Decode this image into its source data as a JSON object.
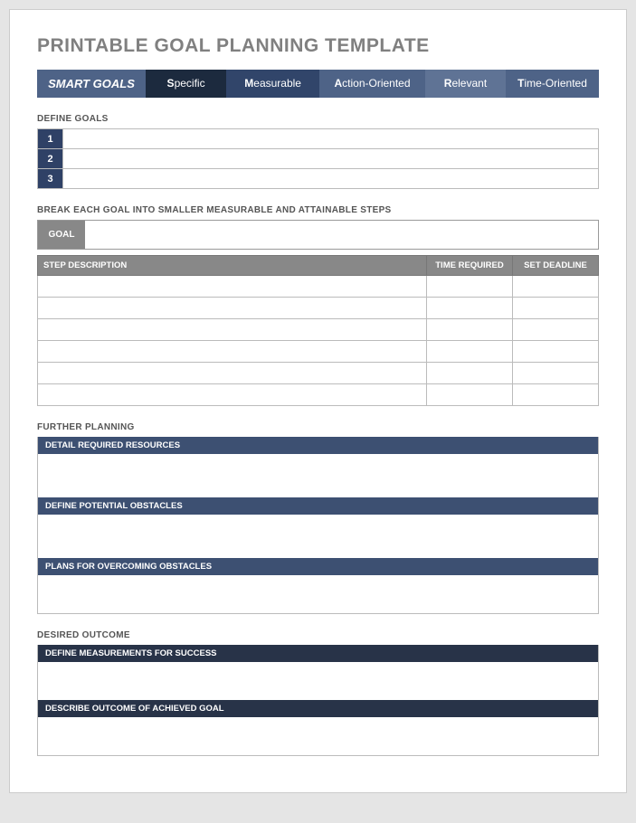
{
  "title": "PRINTABLE GOAL PLANNING TEMPLATE",
  "smart": {
    "main": "SMART GOALS",
    "s_hl": "S",
    "s_rest": "pecific",
    "m_hl": "M",
    "m_rest": "easurable",
    "a_hl": "A",
    "a_rest": "ction-Oriented",
    "r_hl": "R",
    "r_rest": "elevant",
    "t_hl": "T",
    "t_rest": "ime-Oriented"
  },
  "sections": {
    "define_goals": "DEFINE GOALS",
    "break_down": "BREAK EACH GOAL INTO SMALLER MEASURABLE AND ATTAINABLE STEPS",
    "further_planning": "FURTHER PLANNING",
    "desired_outcome": "DESIRED OUTCOME"
  },
  "goals": {
    "n1": "1",
    "n2": "2",
    "n3": "3",
    "v1": "",
    "v2": "",
    "v3": ""
  },
  "goal_label": "GOAL",
  "goal_value": "",
  "steps_headers": {
    "desc": "STEP DESCRIPTION",
    "time": "TIME REQUIRED",
    "deadline": "SET DEADLINE"
  },
  "steps": [
    {
      "desc": "",
      "time": "",
      "deadline": ""
    },
    {
      "desc": "",
      "time": "",
      "deadline": ""
    },
    {
      "desc": "",
      "time": "",
      "deadline": ""
    },
    {
      "desc": "",
      "time": "",
      "deadline": ""
    },
    {
      "desc": "",
      "time": "",
      "deadline": ""
    },
    {
      "desc": "",
      "time": "",
      "deadline": ""
    }
  ],
  "planning": {
    "resources_h": "DETAIL REQUIRED RESOURCES",
    "resources_v": "",
    "obstacles_h": "DEFINE POTENTIAL OBSTACLES",
    "obstacles_v": "",
    "overcome_h": "PLANS FOR OVERCOMING OBSTACLES",
    "overcome_v": ""
  },
  "outcome": {
    "measure_h": "DEFINE MEASUREMENTS FOR SUCCESS",
    "measure_v": "",
    "describe_h": "DESCRIBE OUTCOME OF ACHIEVED GOAL",
    "describe_v": ""
  }
}
